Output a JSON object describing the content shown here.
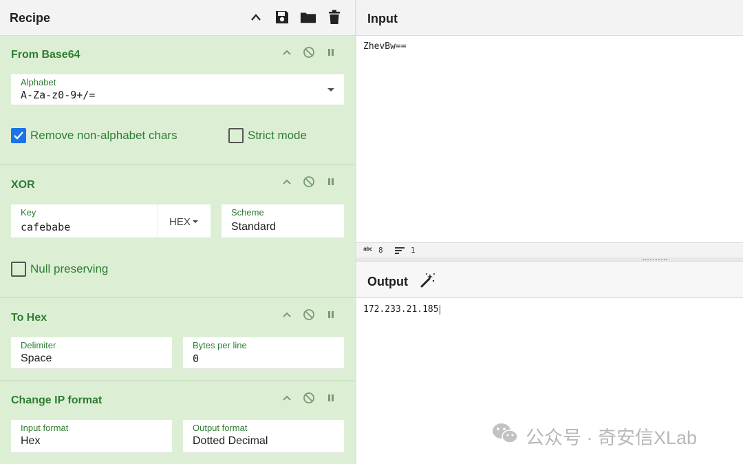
{
  "recipe": {
    "title": "Recipe",
    "header_icons": [
      "chevron-up-icon",
      "save-icon",
      "folder-icon",
      "trash-icon"
    ],
    "operations": [
      {
        "title": "From Base64",
        "fields": [
          {
            "label": "Alphabet",
            "value": "A-Za-z0-9+/="
          }
        ],
        "checkboxes": [
          {
            "label": "Remove non-alphabet chars",
            "checked": true
          },
          {
            "label": "Strict mode",
            "checked": false
          }
        ]
      },
      {
        "title": "XOR",
        "fields": [
          {
            "label": "Key",
            "value": "cafebabe",
            "encoding": "HEX"
          },
          {
            "label": "Scheme",
            "value": "Standard"
          }
        ],
        "checkboxes": [
          {
            "label": "Null preserving",
            "checked": false
          }
        ]
      },
      {
        "title": "To Hex",
        "fields": [
          {
            "label": "Delimiter",
            "value": "Space"
          },
          {
            "label": "Bytes per line",
            "value": "0"
          }
        ]
      },
      {
        "title": "Change IP format",
        "fields": [
          {
            "label": "Input format",
            "value": "Hex"
          },
          {
            "label": "Output format",
            "value": "Dotted Decimal"
          }
        ]
      }
    ]
  },
  "input": {
    "title": "Input",
    "text": "ZhevBw==",
    "status": {
      "length_icon": "abc",
      "length": "8",
      "lines": "1"
    }
  },
  "output": {
    "title": "Output",
    "text": "172.233.21.185"
  },
  "watermark": {
    "text": "公众号 · 奇安信XLab"
  },
  "colors": {
    "recipe_bg": "#dcefd5",
    "op_title": "#2e7d32",
    "checkbox_checked": "#1a73e8",
    "header_bg": "#f3f3f3"
  }
}
